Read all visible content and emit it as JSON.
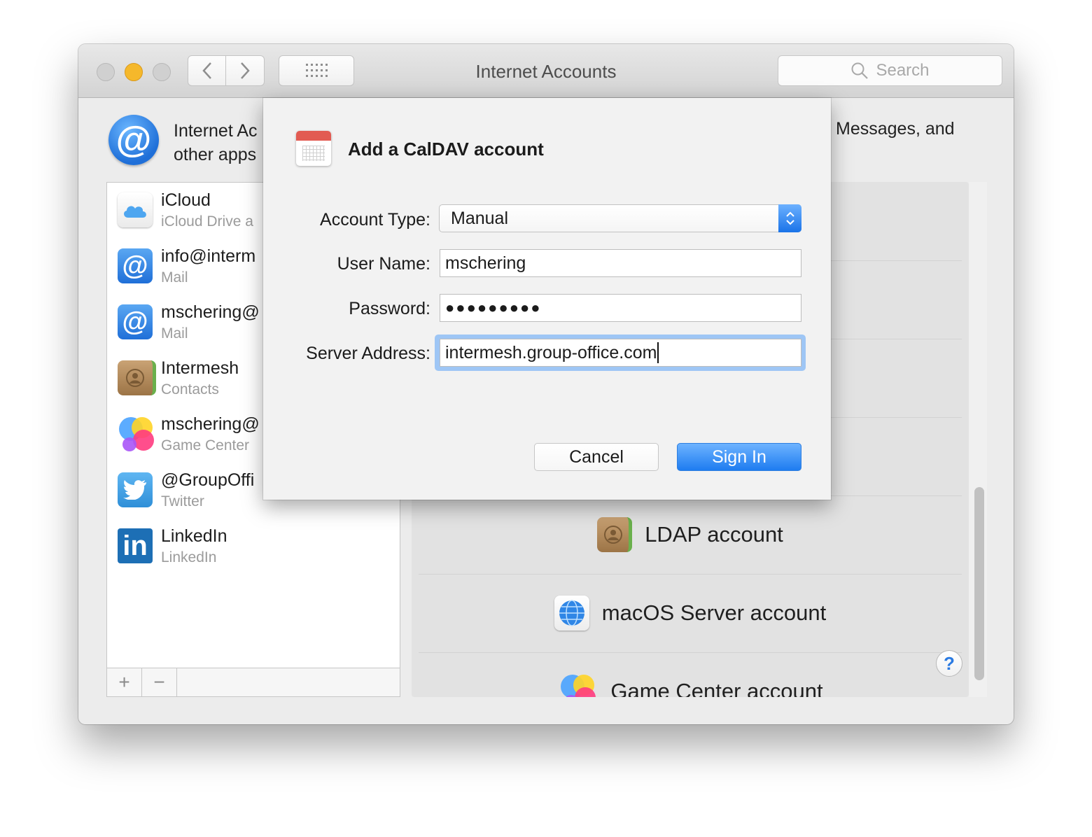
{
  "window": {
    "title": "Internet Accounts",
    "search_placeholder": "Search"
  },
  "header": {
    "line1": "Internet Ac",
    "line2": "other apps",
    "right": "Messages, and"
  },
  "accounts": [
    {
      "name": "iCloud",
      "sub": "iCloud Drive a",
      "icon": "icloud-icon"
    },
    {
      "name": "info@interm",
      "sub": "Mail",
      "icon": "at-icon"
    },
    {
      "name": "mschering@",
      "sub": "Mail",
      "icon": "at-icon"
    },
    {
      "name": "Intermesh",
      "sub": "Contacts",
      "icon": "contacts-icon"
    },
    {
      "name": "mschering@",
      "sub": "Game Center",
      "icon": "game-center-icon"
    },
    {
      "name": "@GroupOffi",
      "sub": "Twitter",
      "icon": "twitter-icon"
    },
    {
      "name": "LinkedIn",
      "sub": "LinkedIn",
      "icon": "linkedin-icon"
    }
  ],
  "list_buttons": {
    "add": "+",
    "remove": "−"
  },
  "account_types": [
    {
      "label": "LDAP account",
      "icon": "contacts-icon"
    },
    {
      "label": "macOS Server account",
      "icon": "server-globe-icon"
    },
    {
      "label": "Game Center account",
      "icon": "game-center-icon"
    }
  ],
  "help_label": "?",
  "dialog": {
    "title": "Add a CalDAV account",
    "labels": {
      "account_type": "Account Type:",
      "user_name": "User Name:",
      "password": "Password:",
      "server_address": "Server Address:"
    },
    "values": {
      "account_type": "Manual",
      "user_name": "mschering",
      "password": "●●●●●●●●●",
      "server_address": "intermesh.group-office.com"
    },
    "cancel_label": "Cancel",
    "signin_label": "Sign In"
  },
  "colors": {
    "accent": "#1e7cf0",
    "traffic_min": "#f5b82b",
    "calendar_red": "#e25b52"
  }
}
